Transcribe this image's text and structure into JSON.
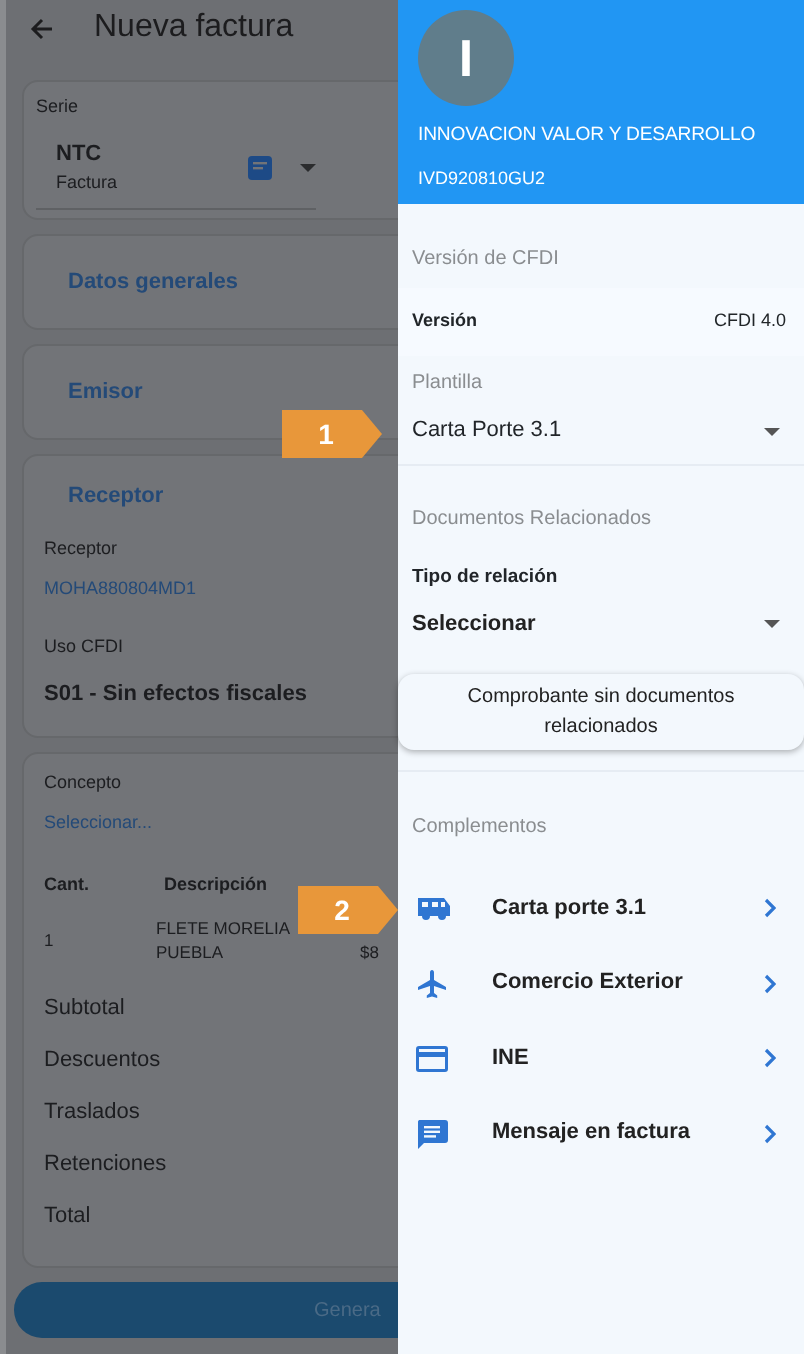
{
  "app_bar": {
    "title": "Nueva factura"
  },
  "serie": {
    "label": "Serie",
    "code": "NTC",
    "name": "Factura"
  },
  "sections": [
    "Datos generales",
    "Emisor"
  ],
  "receptor": {
    "heading": "Receptor",
    "label": "Receptor",
    "value": "MOHA880804MD1",
    "uso_label": "Uso CFDI",
    "uso_value": "S01 - Sin efectos fiscales"
  },
  "concepto": {
    "label": "Concepto",
    "link": "Seleccionar...",
    "columns": [
      "Cant.",
      "Descripción"
    ],
    "rows": [
      {
        "cant": "1",
        "descripcion": "FLETE MORELIA PUEBLA",
        "column_3": "$8"
      }
    ],
    "totals": [
      "Subtotal",
      "Descuentos",
      "Traslados",
      "Retenciones",
      "Total"
    ]
  },
  "primary_button": "Genera",
  "drawer": {
    "initial": "I",
    "name": "INNOVACION VALOR Y DESARROLLO",
    "rfc": "IVD920810GU2",
    "version_heading": "Versión de CFDI",
    "version_label": "Versión",
    "version_value": "CFDI 4.0",
    "plantilla_label": "Plantilla",
    "plantilla_value": "Carta Porte 3.1",
    "docs_heading": "Documentos Relacionados",
    "relacion_label": "Tipo de relación",
    "relacion_value": "Seleccionar",
    "docs_button": "Comprobante sin documentos relacionados",
    "complementos_heading": "Complementos",
    "complementos": [
      {
        "kind": "truck",
        "label": "Carta porte 3.1"
      },
      {
        "kind": "plane",
        "label": "Comercio Exterior"
      },
      {
        "kind": "card",
        "label": "INE"
      },
      {
        "kind": "message",
        "label": "Mensaje en factura"
      }
    ]
  },
  "callouts": [
    "1",
    "2"
  ]
}
